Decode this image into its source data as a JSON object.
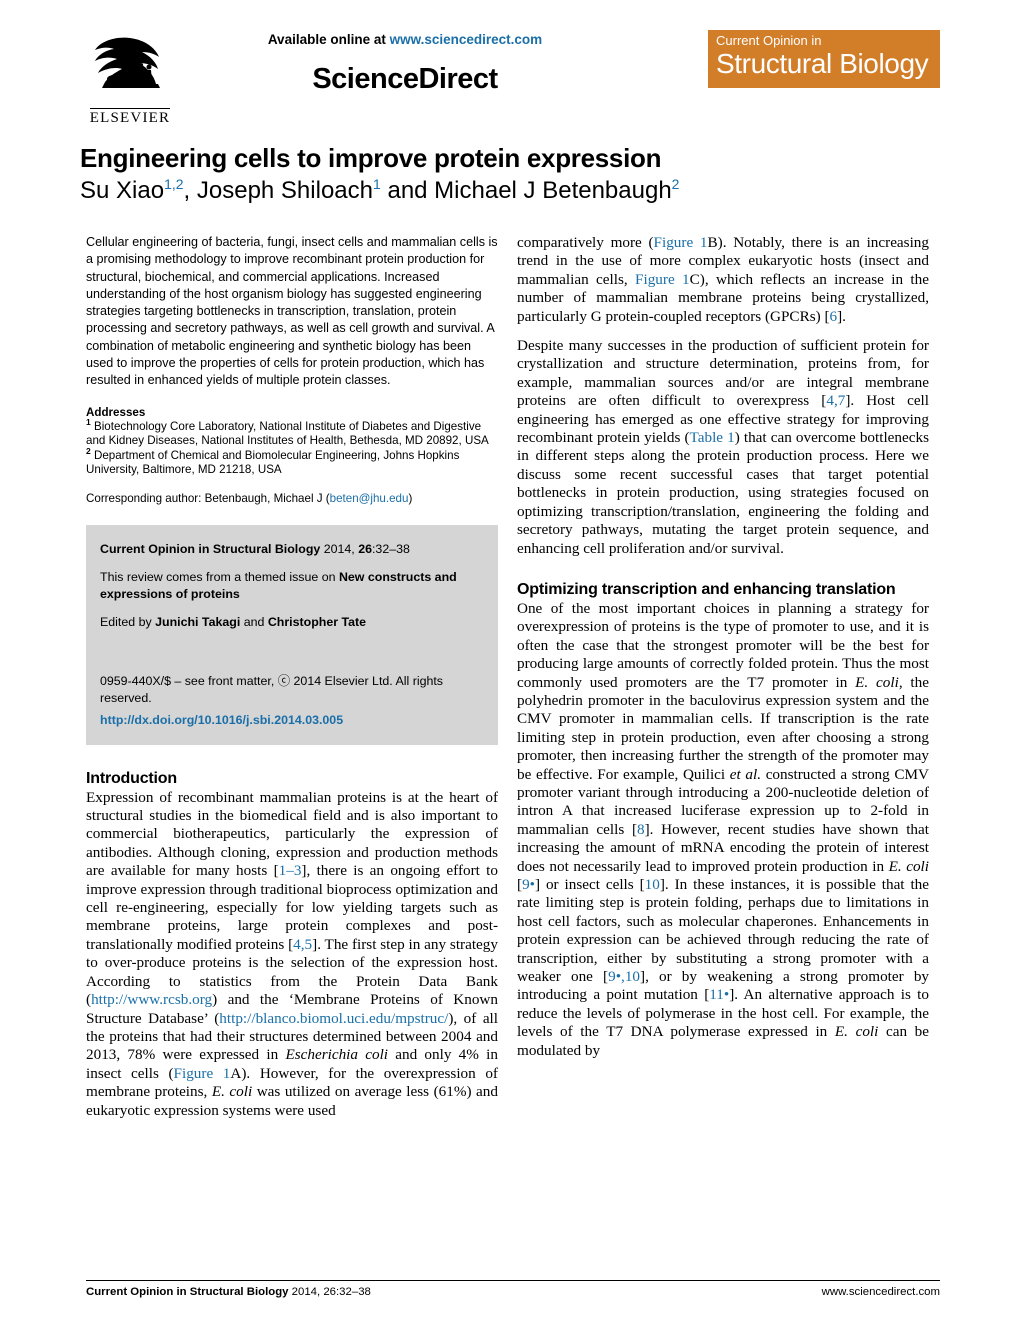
{
  "masthead": {
    "available_online_prefix": "Available online at ",
    "sciencedirect_url": "www.sciencedirect.com",
    "sciencedirect_wordmark": "ScienceDirect",
    "elsevier_wordmark": "ELSEVIER",
    "journal_banner_line1": "Current Opinion in",
    "journal_banner_line2": "Structural Biology",
    "banner_color": "#d27d28",
    "link_color": "#1a6fa8"
  },
  "article": {
    "title": "Engineering cells to improve protein expression",
    "authors_plain": "Su Xiao1,2, Joseph Shiloach1 and Michael J Betenbaugh2"
  },
  "abstract": {
    "text": "Cellular engineering of bacteria, fungi, insect cells and mammalian cells is a promising methodology to improve recombinant protein production for structural, biochemical, and commercial applications. Increased understanding of the host organism biology has suggested engineering strategies targeting bottlenecks in transcription, translation, protein processing and secretory pathways, as well as cell growth and survival. A combination of metabolic engineering and synthetic biology has been used to improve the properties of cells for protein production, which has resulted in enhanced yields of multiple protein classes."
  },
  "addresses": {
    "heading": "Addresses",
    "address1": "Biotechnology Core Laboratory, National Institute of Diabetes and Digestive and Kidney Diseases, National Institutes of Health, Bethesda, MD 20892, USA",
    "address2": "Department of Chemical and Biomolecular Engineering, Johns Hopkins University, Baltimore, MD 21218, USA",
    "corresponding_prefix": "Corresponding author: Betenbaugh, Michael J (",
    "corresponding_email": "beten@jhu.edu",
    "corresponding_suffix": ")"
  },
  "journal_box": {
    "citation_journal": "Current Opinion in Structural Biology",
    "citation_rest": " 2014, ",
    "citation_volume": "26",
    "citation_pages": ":32–38",
    "themed_prefix": "This review comes from a themed issue on ",
    "themed_issue": "New constructs and expressions of proteins",
    "edited_prefix": "Edited by ",
    "editor1": "Junichi Takagi",
    "edited_middle": " and ",
    "editor2": "Christopher Tate",
    "front_matter": "0959-440X/$ – see front matter, ⓒ 2014 Elsevier Ltd. All rights reserved.",
    "doi": "http://dx.doi.org/10.1016/j.sbi.2014.03.005"
  },
  "sections": {
    "introduction_heading": "Introduction",
    "optimizing_heading": "Optimizing transcription and enhancing translation"
  },
  "body": {
    "intro_p1_a": "Expression of recombinant mammalian proteins is at the heart of structural studies in the biomedical field and is also important to commercial biotherapeutics, particularly the expression of antibodies. Although cloning, expression and production methods are available for many hosts [",
    "intro_ref_1_3": "1–3",
    "intro_p1_b": "], there is an ongoing effort to improve expression through traditional bioprocess optimization and cell re-engineering, especially for low yielding targets such as membrane proteins, large protein complexes and post-translationally modified proteins [",
    "intro_ref_4_5": "4,5",
    "intro_p1_c": "]. The first step in any strategy to over-produce proteins is the selection of the expression host. According to statistics from the Protein Data Bank (",
    "intro_url_pdb": "http://www.rcsb.org",
    "intro_p1_d": ") and the ‘Membrane Proteins of Known Structure Database’ (",
    "intro_url_mpstruc": "http://blanco.biomol.uci.edu/mpstruc/",
    "intro_p1_e": "), of all the proteins that had their structures determined between 2004 and 2013, 78% were expressed in ",
    "intro_italic_ecoli_full": "Escherichia coli",
    "intro_p1_f": " and only 4% in insect cells (",
    "intro_fig_1a": "Figure 1",
    "intro_p1_g": "A). However, for the overexpression of membrane proteins, ",
    "intro_italic_ecoli": "E. coli",
    "intro_p1_h": " was utilized on average less (61%) and eukaryotic expression systems were used",
    "right_p1_a": "comparatively more (",
    "right_fig_1b": "Figure 1",
    "right_p1_b": "B). Notably, there is an increasing trend in the use of more complex eukaryotic hosts (insect and mammalian cells, ",
    "right_fig_1c": "Figure 1",
    "right_p1_c": "C), which reflects an increase in the number of mammalian membrane proteins being crystallized, particularly G protein-coupled receptors (GPCRs) [",
    "right_ref_6": "6",
    "right_p1_d": "].",
    "right_p2_a": "Despite many successes in the production of sufficient protein for crystallization and structure determination, proteins from, for example, mammalian sources and/or are integral membrane proteins are often difficult to overexpress [",
    "right_ref_4_7": "4,7",
    "right_p2_b": "]. Host cell engineering has emerged as one effective strategy for improving recombinant protein yields (",
    "right_table_1": "Table 1",
    "right_p2_c": ") that can overcome bottlenecks in different steps along the protein production process. Here we discuss some recent successful cases that target potential bottlenecks in protein production, using strategies focused on optimizing transcription/translation, engineering the folding and secretory pathways, mutating the target protein sequence, and enhancing cell proliferation and/or survival.",
    "right_p3_a": "One of the most important choices in planning a strategy for overexpression of proteins is the type of promoter to use, and it is often the case that the strongest promoter will be the best for producing large amounts of correctly folded protein. Thus the most commonly used promoters are the T7 promoter in ",
    "right_p3_ecoli1": "E. coli",
    "right_p3_b": ", the polyhedrin promoter in the baculovirus expression system and the CMV promoter in mammalian cells. If transcription is the rate limiting step in protein production, even after choosing a strong promoter, then increasing further the strength of the promoter may be effective. For example, Quilici ",
    "right_p3_etal": "et al.",
    "right_p3_c": " constructed a strong CMV promoter variant through introducing a 200-nucleotide deletion of intron A that increased luciferase expression up to 2-fold in mammalian cells [",
    "right_ref_8": "8",
    "right_p3_d": "]. However, recent studies have shown that increasing the amount of mRNA encoding the protein of interest does not necessarily lead to improved protein production in ",
    "right_p3_ecoli2": "E. coli",
    "right_p3_e": " [",
    "right_ref_9star": "9•",
    "right_p3_f": "] or insect cells [",
    "right_ref_10": "10",
    "right_p3_g": "]. In these instances, it is possible that the rate limiting step is protein folding, perhaps due to limitations in host cell factors, such as molecular chaperones. Enhancements in protein expression can be achieved through reducing the rate of transcription, either by substituting a strong promoter with a weaker one [",
    "right_ref_9star10": "9•,10",
    "right_p3_h": "], or by weakening a strong promoter by introducing a point mutation [",
    "right_ref_11star": "11•",
    "right_p3_i": "]. An alternative approach is to reduce the levels of polymerase in the host cell. For example, the levels of the T7 DNA polymerase expressed in ",
    "right_p3_ecoli3": "E. coli",
    "right_p3_j": " can be modulated by"
  },
  "footer": {
    "left_journal": "Current Opinion in Structural Biology",
    "left_rest": " 2014, 26:32–38",
    "right": "www.sciencedirect.com"
  }
}
